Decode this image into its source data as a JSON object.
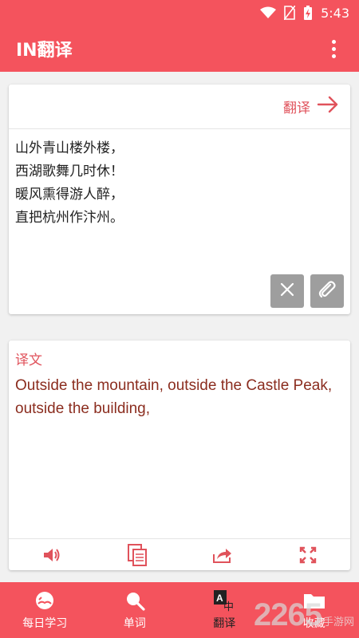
{
  "status_bar": {
    "time": "5:43"
  },
  "app_bar": {
    "title": "IN翻译",
    "menu_icon": "more-vert-icon"
  },
  "input_card": {
    "translate_label": "翻译",
    "source_text": "山外青山楼外楼，\n西湖歌舞几时休！\n暖风熏得游人醉，\n直把杭州作汴州。",
    "clear_icon": "close-icon",
    "attach_icon": "paperclip-icon"
  },
  "output_card": {
    "label": "译文",
    "translation": "Outside the mountain, outside the Castle Peak, outside the building,",
    "actions": [
      "speaker-icon",
      "copy-icon",
      "share-icon",
      "fullscreen-icon"
    ]
  },
  "bottom_nav": {
    "items": [
      {
        "label": "每日学习",
        "icon": "book-icon"
      },
      {
        "label": "单词",
        "icon": "search-icon"
      },
      {
        "label": "翻译",
        "icon": "translate-icon"
      },
      {
        "label": "收藏",
        "icon": "folder-icon"
      }
    ],
    "active": "翻译"
  },
  "watermark": {
    "number": "2265",
    "site": "手游网"
  },
  "colors": {
    "primary": "#f4535d",
    "accent": "#e0525b",
    "translation_text": "#8b2d1f",
    "button_gray": "#9e9e9e"
  }
}
